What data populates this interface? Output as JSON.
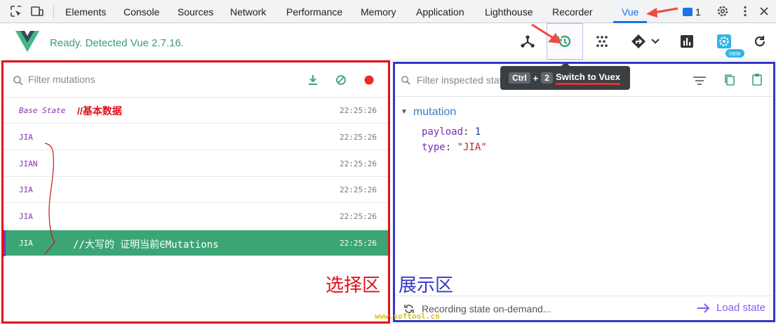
{
  "devtools": {
    "tabs": [
      {
        "label": "Elements"
      },
      {
        "label": "Console"
      },
      {
        "label": "Sources"
      },
      {
        "label": "Network"
      },
      {
        "label": "Performance"
      },
      {
        "label": "Memory"
      },
      {
        "label": "Application"
      },
      {
        "label": "Lighthouse"
      },
      {
        "label": "Recorder"
      },
      {
        "label": "Vue"
      }
    ],
    "active_tab": "Vue",
    "message_count": "1"
  },
  "vue_header": {
    "status": "Ready. Detected Vue 2.7.16.",
    "new_badge": "new"
  },
  "tooltip": {
    "key1": "Ctrl",
    "plus": "+",
    "key2": "2",
    "text": "Switch to Vuex"
  },
  "mutations_panel": {
    "filter_placeholder": "Filter mutations",
    "rows": [
      {
        "name": "Base State",
        "time": "22:25:26"
      },
      {
        "name": "JIA",
        "time": "22:25:26"
      },
      {
        "name": "JIAN",
        "time": "22:25:26"
      },
      {
        "name": "JIA",
        "time": "22:25:26"
      },
      {
        "name": "JIA",
        "time": "22:25:26"
      },
      {
        "name": "JIA",
        "time": "22:25:26"
      }
    ],
    "annotation_base": "//基本数据",
    "annotation_selected": "//大写的 证明当前∈Mutations"
  },
  "state_panel": {
    "filter_placeholder": "Filter inspected state",
    "section_title": "mutation",
    "payload_key": "payload",
    "payload_value": "1",
    "type_key": "type",
    "type_value": "\"JIA\"",
    "recording_text": "Recording state on-demand...",
    "load_label": "Load state"
  },
  "annotations": {
    "left_label": "选择区",
    "right_label": "展示区",
    "watermark": "www.softool.cn"
  },
  "colors": {
    "vue_green": "#3ca575",
    "red_frame": "#e0101a",
    "blue_frame": "#3337c9",
    "accent_blue": "#1a73e8",
    "purple": "#8a5cf0"
  }
}
